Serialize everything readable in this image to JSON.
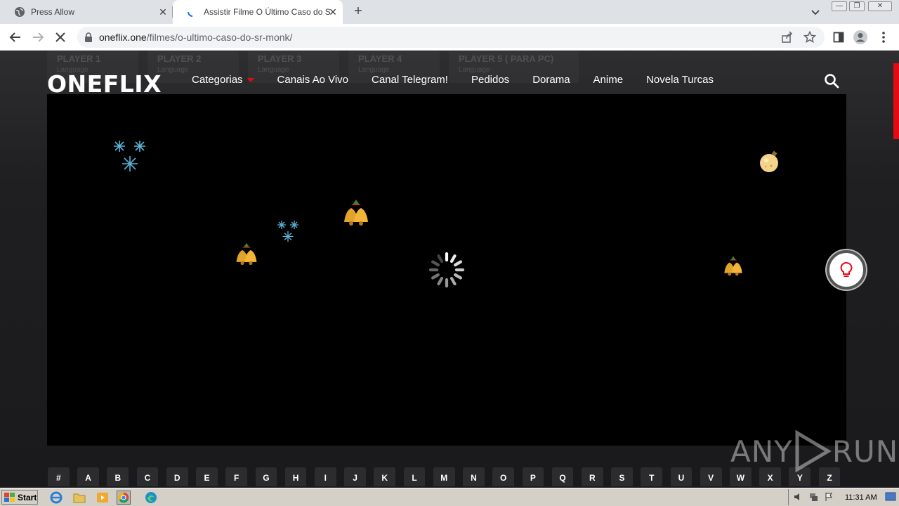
{
  "browser": {
    "tabs": [
      {
        "title": "Press Allow",
        "icon": "globe-icon"
      },
      {
        "title": "Assistir Filme O Último Caso do Sr. M",
        "icon": "loading-icon"
      }
    ],
    "url_host": "oneflix.one",
    "url_path": "/filmes/o-ultimo-caso-do-sr-monk/"
  },
  "site": {
    "logo": "ONEFLIX",
    "nav": [
      "Categorias",
      "Canais Ao Vivo",
      "Canal Telegram!",
      "Pedidos",
      "Dorama",
      "Anime",
      "Novela Turcas"
    ],
    "players": [
      {
        "title": "PLAYER 1",
        "lang": "Language"
      },
      {
        "title": "PLAYER 2",
        "lang": "Language"
      },
      {
        "title": "PLAYER 3",
        "lang": "Language"
      },
      {
        "title": "PLAYER 4",
        "lang": "Language"
      },
      {
        "title": "PLAYER 5 ( PARA PC)",
        "lang": "Language"
      }
    ],
    "alphabet": [
      "#",
      "A",
      "B",
      "C",
      "D",
      "E",
      "F",
      "G",
      "H",
      "I",
      "J",
      "K",
      "L",
      "M",
      "N",
      "O",
      "P",
      "Q",
      "R",
      "S",
      "T",
      "U",
      "V",
      "W",
      "X",
      "Y",
      "Z"
    ],
    "accent_color": "#e50914"
  },
  "watermark": {
    "left": "ANY",
    "right": "RUN"
  },
  "taskbar": {
    "start": "Start",
    "clock": "11:31 AM"
  }
}
